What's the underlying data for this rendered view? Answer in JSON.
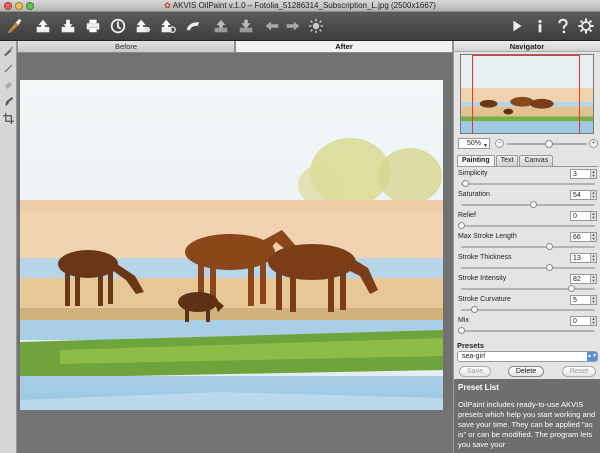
{
  "window": {
    "title": "AKVIS OilPaint v.1.0 – Fotolia_51286314_Subscription_L.jpg (2500x1667)"
  },
  "toolbar": {
    "left_icons": [
      "paint-brush-icon",
      "open-file-icon",
      "save-file-icon",
      "print-icon",
      "batch-process-icon",
      "share-icon",
      "preferences-icon",
      "apply-icon",
      "undo-icon",
      "redo-icon",
      "back-arrow-icon",
      "forward-arrow-icon",
      "settings-sun-icon"
    ],
    "right_icons": [
      "run-icon",
      "info-icon",
      "help-icon",
      "gear-icon"
    ]
  },
  "tools": [
    "brush-tool-icon",
    "pencil-tool-icon",
    "eraser-tool-icon",
    "smudge-tool-icon",
    "crop-tool-icon"
  ],
  "view_tabs": {
    "before": "Before",
    "after": "After",
    "active": "after"
  },
  "navigator": {
    "title": "Navigator",
    "zoom_value": "50%",
    "zoom_fraction": 0.52
  },
  "settings": {
    "tabs": [
      "Painting",
      "Text",
      "Canvas"
    ],
    "active_tab": "Painting",
    "params": [
      {
        "label": "Simplicity",
        "value": "3",
        "fraction": 0.03
      },
      {
        "label": "Saturation",
        "value": "54",
        "fraction": 0.54
      },
      {
        "label": "Relief",
        "value": "0",
        "fraction": 0.0
      },
      {
        "label": "Max Stroke Length",
        "value": "66",
        "fraction": 0.66
      },
      {
        "label": "Stroke Thickness",
        "value": "13",
        "fraction": 0.66
      },
      {
        "label": "Stroke Intensity",
        "value": "82",
        "fraction": 0.82
      },
      {
        "label": "Stroke Curvature",
        "value": "5",
        "fraction": 0.1
      },
      {
        "label": "Mix",
        "value": "0",
        "fraction": 0.0
      }
    ]
  },
  "presets": {
    "title": "Presets",
    "selected": "sea-girl",
    "save_label": "Save",
    "delete_label": "Delete",
    "reset_label": "Reset"
  },
  "help": {
    "title": "Preset List",
    "text": "OilPaint includes ready-to-use AKVIS presets which help you start working and save your time. They can be applied \"as is\" or can be modified. The program lets you save your"
  },
  "colors": {
    "toolbar_dark": "#3d3d3d",
    "panel_bg": "#e4e4e4",
    "accent_blue": "#5a8fd4"
  }
}
